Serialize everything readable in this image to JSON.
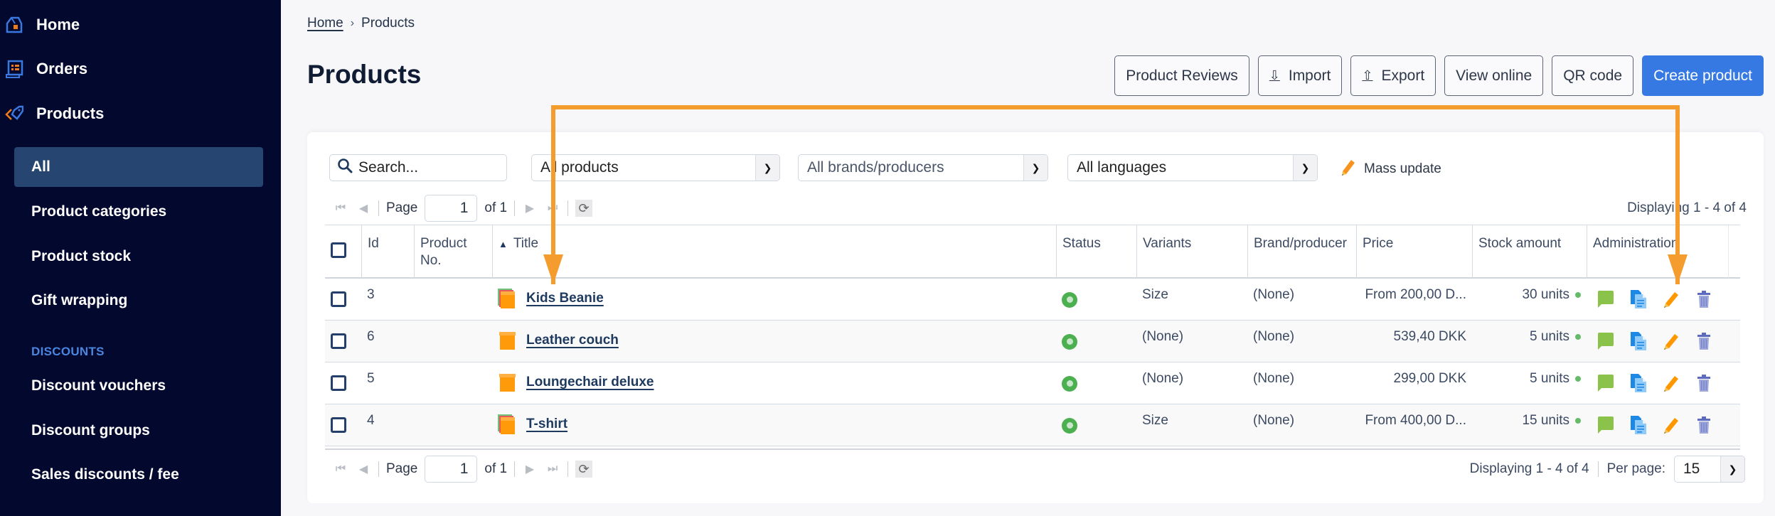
{
  "sidebar": {
    "top_items": [
      {
        "label": "Home",
        "icon": "home-icon"
      },
      {
        "label": "Orders",
        "icon": "orders-icon"
      },
      {
        "label": "Products",
        "icon": "tag-icon"
      }
    ],
    "sub_items": [
      {
        "label": "All",
        "active": true
      },
      {
        "label": "Product categories"
      },
      {
        "label": "Product stock"
      },
      {
        "label": "Gift wrapping"
      }
    ],
    "section_label": "DISCOUNTS",
    "section_items": [
      {
        "label": "Discount vouchers"
      },
      {
        "label": "Discount groups"
      },
      {
        "label": "Sales discounts / fee"
      }
    ]
  },
  "breadcrumb": {
    "home": "Home",
    "separator": "›",
    "current": "Products"
  },
  "page_title": "Products",
  "toolbar": {
    "product_reviews": "Product Reviews",
    "import": "Import",
    "export": "Export",
    "view_online": "View online",
    "qr_code": "QR code",
    "create_product": "Create product"
  },
  "filters": {
    "search_placeholder": "Search...",
    "products_select": "All products",
    "brands_select": "All brands/producers",
    "languages_select": "All languages",
    "mass_update": "Mass update"
  },
  "pager": {
    "page_label": "Page",
    "page_value": "1",
    "of_label": "of 1",
    "displaying": "Displaying 1 - 4 of 4",
    "per_page_label": "Per page:",
    "per_page_value": "15"
  },
  "table": {
    "columns": [
      "",
      "Id",
      "Product No.",
      "Title",
      "Status",
      "Variants",
      "Brand/producer",
      "Price",
      "Stock amount",
      "Administration"
    ],
    "sort_indicator": "▲",
    "rows": [
      {
        "id": "3",
        "product_no": "",
        "title": "Kids Beanie",
        "status": "active",
        "variants": "Size",
        "brand": "(None)",
        "price": "From 200,00 D...",
        "stock": "30 units",
        "multi": true
      },
      {
        "id": "6",
        "product_no": "",
        "title": "Leather couch",
        "status": "active",
        "variants": "(None)",
        "brand": "(None)",
        "price": "539,40 DKK",
        "stock": "5 units",
        "multi": false
      },
      {
        "id": "5",
        "product_no": "",
        "title": "Loungechair deluxe",
        "status": "active",
        "variants": "(None)",
        "brand": "(None)",
        "price": "299,00 DKK",
        "stock": "5 units",
        "multi": false
      },
      {
        "id": "4",
        "product_no": "",
        "title": "T-shirt",
        "status": "active",
        "variants": "Size",
        "brand": "(None)",
        "price": "From 400,00 D...",
        "stock": "15 units",
        "multi": true
      }
    ]
  },
  "colors": {
    "sidebar_bg": "#03082e",
    "sidebar_active": "#264570",
    "primary": "#3679e3",
    "annotation": "#f59c2f",
    "status_active": "#4caf50"
  }
}
